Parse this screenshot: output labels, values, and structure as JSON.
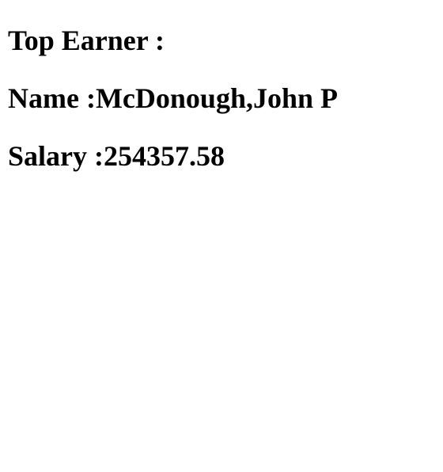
{
  "report": {
    "heading": "Top Earner :",
    "name_label": "Name :",
    "name_value": "McDonough,John P",
    "salary_label": "Salary :",
    "salary_value": "254357.58"
  }
}
